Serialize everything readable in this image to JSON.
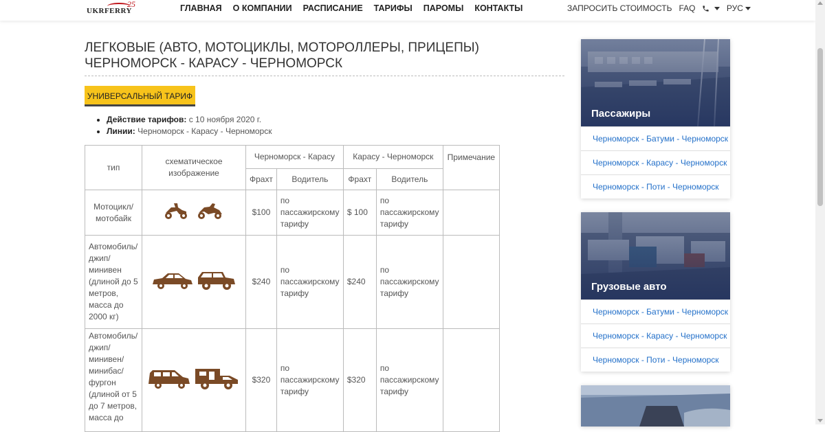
{
  "header": {
    "logo_text": "UKRFERRY",
    "logo_number": "25",
    "nav": [
      "ГЛАВНАЯ",
      "О КОМПАНИИ",
      "РАСПИСАНИЕ",
      "ТАРИФЫ",
      "ПАРОМЫ",
      "КОНТАКТЫ"
    ],
    "request_price": "ЗАПРОСИТЬ СТОИМОСТЬ",
    "faq": "FAQ",
    "language": "РУС"
  },
  "page": {
    "title_line1": "ЛЕГКОВЫЕ (АВТО, МОТОЦИКЛЫ, МОТОРОЛЛЕРЫ, ПРИЦЕПЫ)",
    "title_line2": "ЧЕРНОМОРСК - КАРАСУ - ЧЕРНОМОРСК",
    "tariff_button": "УНИВЕРСАЛЬНЫЙ ТАРИФ",
    "info": [
      {
        "label": "Действие тарифов:",
        "value": "с 10 ноября 2020 г."
      },
      {
        "label": "Линии:",
        "value": "Черноморск - Карасу - Черноморск"
      }
    ]
  },
  "table": {
    "headers": {
      "type": "тип",
      "scheme": "схематическое изображение",
      "dir1": "Черноморск - Карасу",
      "dir2": "Карасу - Черноморск",
      "note": "Примечание",
      "freight": "Фрахт",
      "driver": "Водитель"
    },
    "rows": [
      {
        "type": "Мотоцикл/ мотобайк",
        "freight1": "$100",
        "driver1": "по пассажирскому тарифу",
        "freight2": "$ 100",
        "driver2": "по пассажирскому тарифу",
        "note": ""
      },
      {
        "type": "Автомобиль/ джип/ минивен (длиной до 5 метров, масса до 2000 кг)",
        "freight1": "$240",
        "driver1": "по пассажирскому тарифу",
        "freight2": "$240",
        "driver2": "по пассажирскому тарифу",
        "note": ""
      },
      {
        "type": "Автомобиль/ джип/ минивен/ минибас/ фургон (длиной от 5 до 7 метров, масса до",
        "freight1": "$320",
        "driver1": "по пассажирскому тарифу",
        "freight2": "$320",
        "driver2": "по пассажирскому тарифу",
        "note": ""
      }
    ]
  },
  "sidebar": [
    {
      "caption": "Пассажиры",
      "links": [
        "Черноморск - Батуми - Черноморск",
        "Черноморск - Карасу - Черноморск",
        "Черноморск - Поти - Черноморск"
      ]
    },
    {
      "caption": "Грузовые авто",
      "links": [
        "Черноморск - Батуми - Черноморск",
        "Черноморск - Карасу - Черноморск",
        "Черноморск - Поти - Черноморск"
      ]
    }
  ],
  "colors": {
    "accent": "#f7c31b",
    "link": "#2370c9",
    "icon": "#7a4a26",
    "brand_red": "#c0151b"
  },
  "icons": [
    "phone-icon",
    "motorcycle-icon",
    "car-icon",
    "minivan-icon"
  ]
}
